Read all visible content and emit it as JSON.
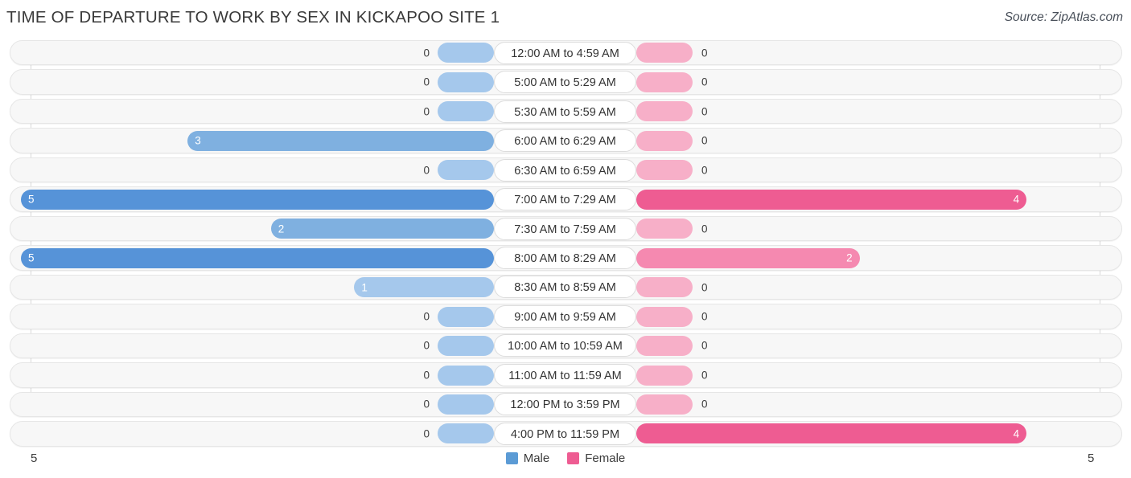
{
  "header": {
    "title": "TIME OF DEPARTURE TO WORK BY SEX IN KICKAPOO SITE 1",
    "source": "Source: ZipAtlas.com"
  },
  "legend": {
    "items": [
      {
        "label": "Male",
        "color": "#5B9BD5"
      },
      {
        "label": "Female",
        "color": "#EE5C92"
      }
    ]
  },
  "axis": {
    "left_max_label": "5",
    "right_max_label": "5"
  },
  "colors": {
    "male_strong": "#5693D8",
    "male_light": "#A5C8EC",
    "female_strong": "#EE5C92",
    "female_mid": "#F589B0",
    "female_light": "#F7AFC8",
    "track_bg": "#F7F7F7",
    "track_border": "#E6E6E6",
    "gridline": "#D9D9D9"
  },
  "chart_data": {
    "type": "bar",
    "title": "TIME OF DEPARTURE TO WORK BY SEX IN KICKAPOO SITE 1",
    "orientation": "horizontal-diverging",
    "xlabel": "",
    "ylabel": "",
    "xlim": [
      5,
      5
    ],
    "grid": true,
    "legend_position": "bottom-center",
    "categories": [
      "12:00 AM to 4:59 AM",
      "5:00 AM to 5:29 AM",
      "5:30 AM to 5:59 AM",
      "6:00 AM to 6:29 AM",
      "6:30 AM to 6:59 AM",
      "7:00 AM to 7:29 AM",
      "7:30 AM to 7:59 AM",
      "8:00 AM to 8:29 AM",
      "8:30 AM to 8:59 AM",
      "9:00 AM to 9:59 AM",
      "10:00 AM to 10:59 AM",
      "11:00 AM to 11:59 AM",
      "12:00 PM to 3:59 PM",
      "4:00 PM to 11:59 PM"
    ],
    "series": [
      {
        "name": "Male",
        "values": [
          0,
          0,
          0,
          3,
          0,
          5,
          2,
          5,
          1,
          0,
          0,
          0,
          0,
          0
        ]
      },
      {
        "name": "Female",
        "values": [
          0,
          0,
          0,
          0,
          0,
          4,
          0,
          2,
          0,
          0,
          0,
          0,
          0,
          4
        ]
      }
    ]
  },
  "rows": [
    {
      "category": "12:00 AM to 4:59 AM",
      "male": "0",
      "female": "0"
    },
    {
      "category": "5:00 AM to 5:29 AM",
      "male": "0",
      "female": "0"
    },
    {
      "category": "5:30 AM to 5:59 AM",
      "male": "0",
      "female": "0"
    },
    {
      "category": "6:00 AM to 6:29 AM",
      "male": "3",
      "female": "0"
    },
    {
      "category": "6:30 AM to 6:59 AM",
      "male": "0",
      "female": "0"
    },
    {
      "category": "7:00 AM to 7:29 AM",
      "male": "5",
      "female": "4"
    },
    {
      "category": "7:30 AM to 7:59 AM",
      "male": "2",
      "female": "0"
    },
    {
      "category": "8:00 AM to 8:29 AM",
      "male": "5",
      "female": "2"
    },
    {
      "category": "8:30 AM to 8:59 AM",
      "male": "1",
      "female": "0"
    },
    {
      "category": "9:00 AM to 9:59 AM",
      "male": "0",
      "female": "0"
    },
    {
      "category": "10:00 AM to 10:59 AM",
      "male": "0",
      "female": "0"
    },
    {
      "category": "11:00 AM to 11:59 AM",
      "male": "0",
      "female": "0"
    },
    {
      "category": "12:00 PM to 3:59 PM",
      "male": "0",
      "female": "0"
    },
    {
      "category": "4:00 PM to 11:59 PM",
      "male": "0",
      "female": "4"
    }
  ]
}
